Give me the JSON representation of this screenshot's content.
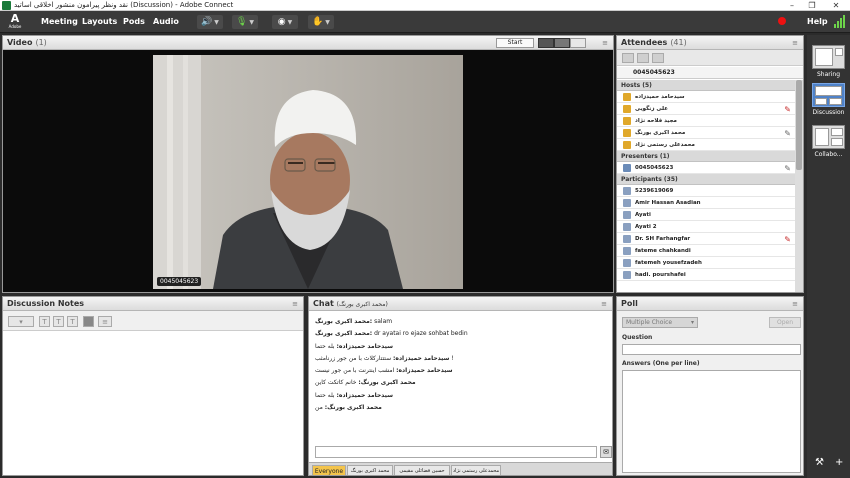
{
  "window": {
    "title": "نقد ونظر پیرامون منشور اخلاقی اساتید (Discussion) - Adobe Connect",
    "minimize": "–",
    "restore": "❐",
    "close": "✕"
  },
  "logo": {
    "mark": "A",
    "text": "Adobe"
  },
  "menu": [
    "Meeting",
    "Layouts",
    "Pods",
    "Audio"
  ],
  "help": "Help",
  "video_pod": {
    "title": "Video",
    "count": "(1)",
    "start_label": "Start",
    "menu_glyph": "≡",
    "stream_label": "0045045623"
  },
  "attendees_pod": {
    "title": "Attendees",
    "count": "(41)",
    "me": "0045045623",
    "groups": [
      {
        "label": "Hosts (5)",
        "role": "host",
        "members": [
          "سیدحامد حمیدزاده",
          "علی زنگویی",
          "مجید فلاحه نژاد",
          "محمد اکبری بورنگ",
          "محمدعلی رستمی نژاد"
        ]
      },
      {
        "label": "Presenters (1)",
        "role": "presenter",
        "members": [
          "0045045623"
        ]
      },
      {
        "label": "Participants (35)",
        "role": "participant",
        "members": [
          "5239619069",
          "Amir Hassan Asadian",
          "Ayati",
          "Ayati 2",
          "Dr. SH Farhangfar",
          "fateme chahkandi",
          "fatemeh yousefzadeh",
          "hadi. pourshafei"
        ]
      }
    ]
  },
  "notes_pod": {
    "title": "Discussion Notes"
  },
  "chat_pod": {
    "title": "Chat",
    "subtitle": "(محمد اکبری بورنگ)",
    "messages": [
      {
        "from": "محمد اکبری بورنگ:",
        "text": " salam"
      },
      {
        "from": "محمد اکبری بورنگ:",
        "text": " dr ayatai ro ejaze sohbat bedin"
      },
      {
        "from": "سیدحامد حمیدزاده:",
        "text": " بله حتما"
      },
      {
        "from": "سیدحامد حمیدزاده:",
        "text": " ستتتارکلاث با من جور زرنامثب !"
      },
      {
        "from": "سیدحامد حمیدزاده:",
        "text": " امشب اینترنت با من جور نیست"
      },
      {
        "from": "محمد اکبری بورنگ:",
        "text": " خانم کاتکت کاین"
      },
      {
        "from": "سیدحامد حمیدزاده:",
        "text": " بله حتما"
      },
      {
        "from": "محمد اکبری بورنگ:",
        "text": " من"
      }
    ],
    "send_glyph": "💬",
    "tabs": [
      "Everyone",
      "محمد اکبری بورنگ",
      "حسین فضائلی مقیمی",
      "محمدعلی رستمی نژاد"
    ]
  },
  "poll_pod": {
    "title": "Poll",
    "type_value": "Multiple Choice",
    "open_label": "Open",
    "question_label": "Question",
    "answers_label": "Answers (One per line)"
  },
  "rail": [
    {
      "label": "Sharing",
      "active": false
    },
    {
      "label": "Discussion",
      "active": true
    },
    {
      "label": "Collabo...",
      "active": false
    }
  ],
  "rail_bottom": {
    "tools": "⚒",
    "add": "+"
  },
  "colors": {
    "accent": "#4f82c8",
    "mic_green": "#6dd34a",
    "record": "#ee1111",
    "chat_tab_active": "#f3c44c"
  }
}
